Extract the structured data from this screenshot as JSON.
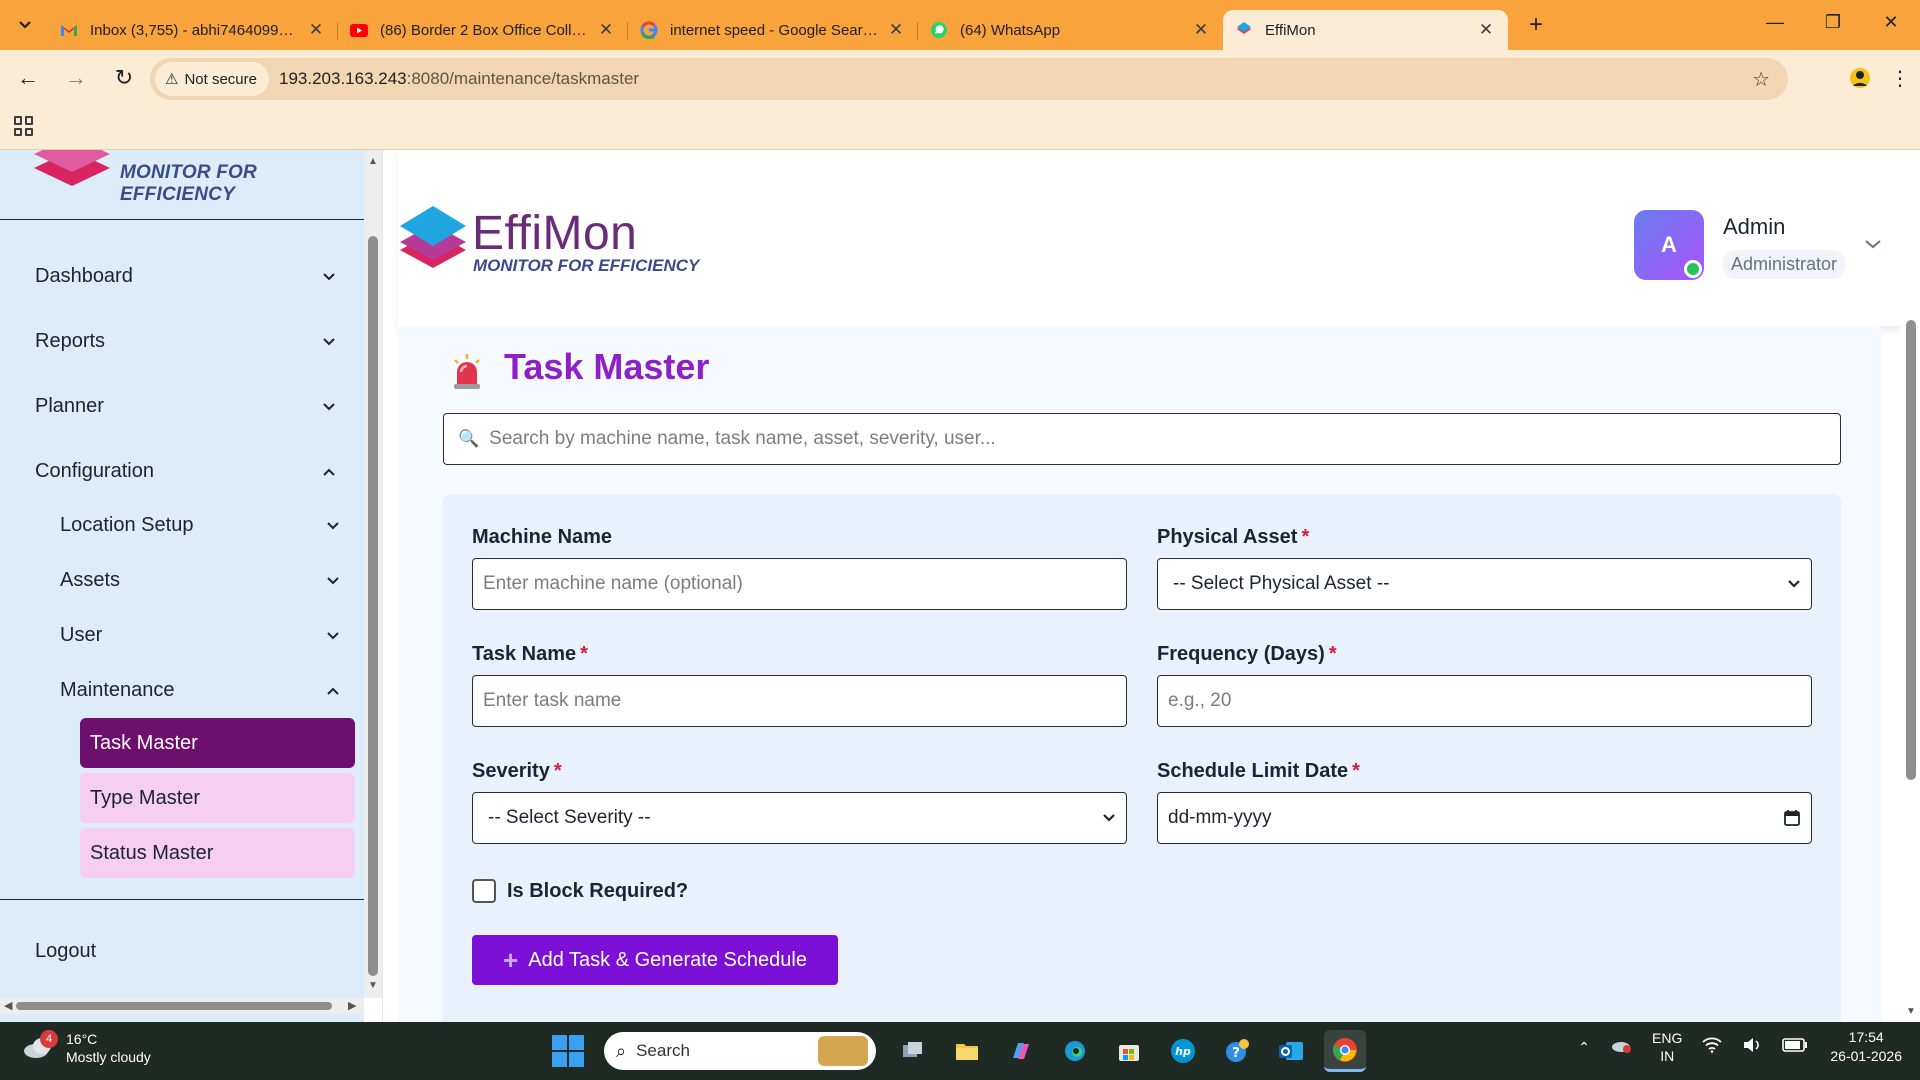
{
  "browser": {
    "tabs": [
      {
        "title": "Inbox (3,755) - abhi7464099@g",
        "icon": "gmail-icon"
      },
      {
        "title": "(86) Border 2 Box Office Collect",
        "icon": "youtube-icon"
      },
      {
        "title": "internet speed - Google Search",
        "icon": "google-icon"
      },
      {
        "title": "(64) WhatsApp",
        "icon": "whatsapp-icon"
      },
      {
        "title": "EffiMon",
        "icon": "effimon-icon",
        "active": true
      }
    ],
    "security_label": "Not secure",
    "url_host": "193.203.163.243",
    "url_path": ":8080/maintenance/taskmaster"
  },
  "sidebar": {
    "brand_tagline": "MONITOR FOR EFFICIENCY",
    "items": [
      {
        "label": "Dashboard",
        "expanded": false
      },
      {
        "label": "Reports",
        "expanded": false
      },
      {
        "label": "Planner",
        "expanded": false
      },
      {
        "label": "Configuration",
        "expanded": true
      }
    ],
    "config_items": [
      {
        "label": "Location Setup",
        "expanded": false
      },
      {
        "label": "Assets",
        "expanded": false
      },
      {
        "label": "User",
        "expanded": false
      },
      {
        "label": "Maintenance",
        "expanded": true
      }
    ],
    "maintenance_items": [
      {
        "label": "Task Master",
        "active": true
      },
      {
        "label": "Type Master",
        "active": false
      },
      {
        "label": "Status Master",
        "active": false
      }
    ],
    "logout_label": "Logout"
  },
  "header": {
    "brand_name": "EffiMon",
    "brand_tagline": "MONITOR FOR EFFICIENCY",
    "avatar_initial": "A",
    "user_name": "Admin",
    "user_role": "Administrator"
  },
  "main": {
    "title": "Task Master",
    "search_placeholder": "Search by machine name, task name, asset, severity, user...",
    "form": {
      "machine_label": "Machine Name",
      "machine_placeholder": "Enter machine name (optional)",
      "asset_label": "Physical Asset",
      "asset_value": "-- Select Physical Asset --",
      "task_label": "Task Name",
      "task_placeholder": "Enter task name",
      "frequency_label": "Frequency (Days)",
      "frequency_placeholder": "e.g., 20",
      "severity_label": "Severity",
      "severity_value": "-- Select Severity --",
      "schedule_label": "Schedule Limit Date",
      "schedule_value": "dd-mm-yyyy",
      "required_mark": "*",
      "block_label": "Is Block Required?",
      "submit_label": "Add Task & Generate Schedule"
    }
  },
  "taskbar": {
    "weather_badge": "4",
    "weather_temp": "16°C",
    "weather_desc": "Mostly cloudy",
    "search_label": "Search",
    "lang_1": "ENG",
    "lang_2": "IN",
    "time": "17:54",
    "date": "26-01-2026"
  }
}
